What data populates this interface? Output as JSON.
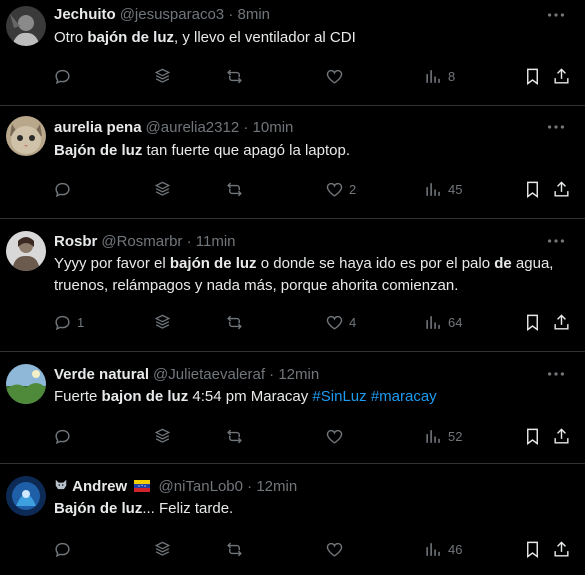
{
  "tweets": [
    {
      "name": "Jechuito",
      "handle": "@jesusparaco3",
      "time": "8min",
      "text_parts": [
        {
          "t": "Otro ",
          "b": false
        },
        {
          "t": "bajón de luz",
          "b": true
        },
        {
          "t": ", y llevo el ventilador al CDI",
          "b": false
        }
      ],
      "replies": "",
      "likes": "",
      "views": "8"
    },
    {
      "name": "aurelia pena",
      "handle": "@aurelia2312",
      "time": "10min",
      "text_parts": [
        {
          "t": "Bajón de luz",
          "b": true
        },
        {
          "t": " tan fuerte que apagó la laptop.",
          "b": false
        }
      ],
      "replies": "",
      "likes": "2",
      "views": "45"
    },
    {
      "name": "Rosbr",
      "handle": "@Rosmarbr",
      "time": "11min",
      "text_line1": [
        {
          "t": "Yyyy por favor el ",
          "b": false
        },
        {
          "t": "bajón de luz",
          "b": true
        },
        {
          "t": " o donde se haya ido es por el palo ",
          "b": false
        },
        {
          "t": "de",
          "b": true
        },
        {
          "t": " agua,",
          "b": false
        }
      ],
      "text_line2": "truenos, relámpagos y nada más, porque ahorita comienzan.",
      "replies": "1",
      "likes": "4",
      "views": "64"
    },
    {
      "name": "Verde natural",
      "handle": "@Julietaevaleraf",
      "time": "12min",
      "text_parts": [
        {
          "t": "Fuerte ",
          "b": false
        },
        {
          "t": "bajon de luz",
          "b": true
        },
        {
          "t": " 4:54 pm Maracay ",
          "b": false
        }
      ],
      "hashtags": [
        "#SinLuz",
        "#maracay"
      ],
      "replies": "",
      "likes": "",
      "views": "52"
    },
    {
      "name": "Andrew",
      "handle": "@niTanLob0",
      "time": "12min",
      "text_parts": [
        {
          "t": "Bajón de luz",
          "b": true
        },
        {
          "t": "... Feliz tarde.",
          "b": false
        }
      ],
      "replies": "",
      "likes": "",
      "views": "46"
    }
  ],
  "separator": "·",
  "icons": {
    "reply": "reply-icon",
    "grok": "stack-icon",
    "retweet": "retweet-icon",
    "like": "heart-icon",
    "views": "views-icon",
    "bookmark": "bookmark-icon",
    "share": "share-icon",
    "more": "more-icon"
  },
  "colors": {
    "background": "#000000",
    "text": "#e7e9ea",
    "muted": "#71767b",
    "link": "#1d9bf0",
    "divider": "#2f3336"
  }
}
